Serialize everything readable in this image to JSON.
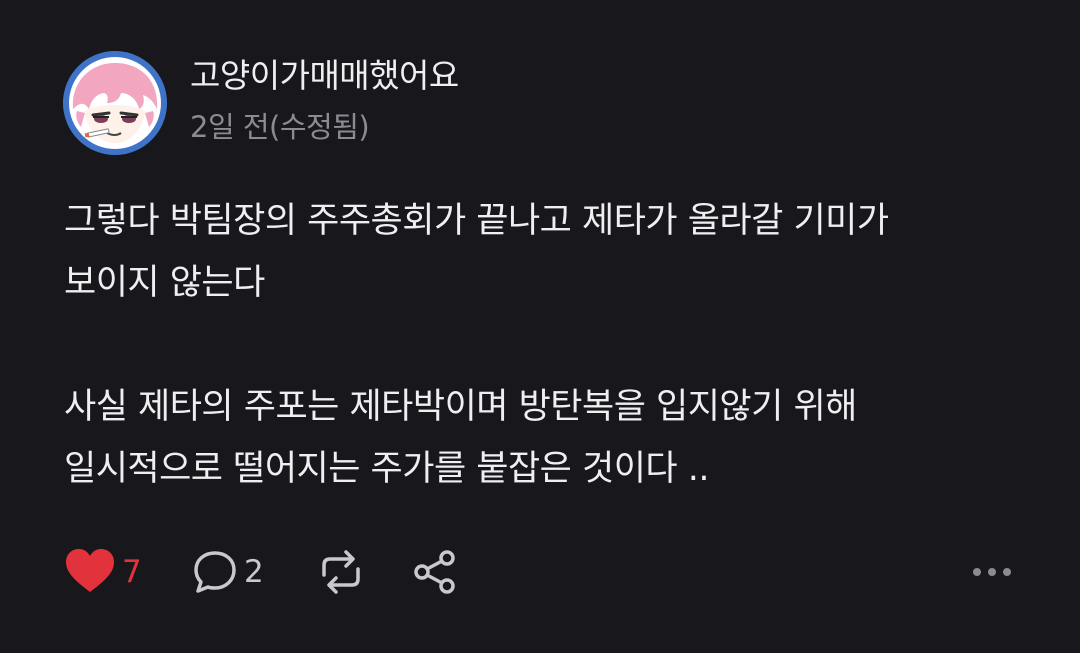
{
  "post": {
    "author": "고양이가매매했어요",
    "timestamp": "2일 전(수정됨)",
    "paragraphs": [
      {
        "lines": [
          "그렇다 박팀장의 주주총회가 끝나고 제타가 올라갈 기미가",
          "보이지 않는다"
        ]
      },
      {
        "lines": [
          "사실 제타의 주포는 제타박이며 방탄복을 입지않기 위해",
          "일시적으로 떨어지는 주가를 붙잡은 것이다 .."
        ]
      }
    ]
  },
  "actions": {
    "like_count": "7",
    "reply_count": "2",
    "like_color": "#e2333d",
    "icon_color": "#c9c8cf"
  },
  "icons": {
    "like": "heart-icon",
    "reply": "comment-icon",
    "repost": "repost-icon",
    "share": "share-icon",
    "more": "more-dots-icon"
  }
}
